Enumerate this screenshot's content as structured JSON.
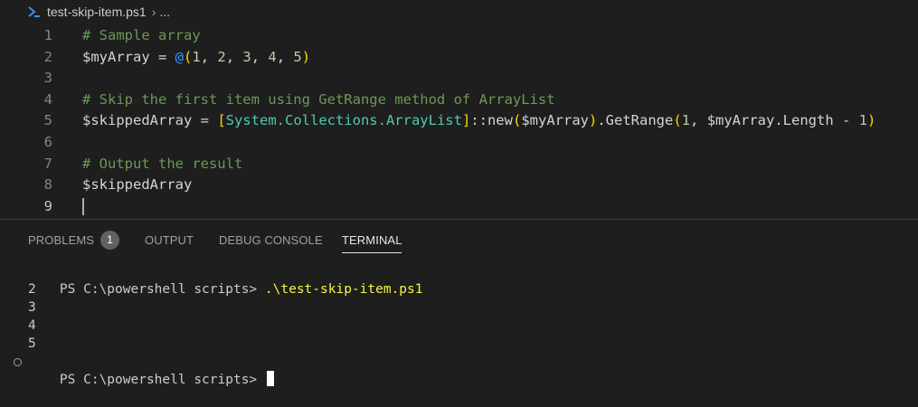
{
  "breadcrumb": {
    "file": "test-skip-item.ps1",
    "chevron": "›",
    "more": "..."
  },
  "editor": {
    "lines": [
      {
        "num": "1",
        "tokens": [
          {
            "t": "# Sample array",
            "k": "comment"
          }
        ]
      },
      {
        "num": "2",
        "tokens": [
          {
            "t": "$myArray",
            "k": "var"
          },
          {
            "t": " = ",
            "k": "op"
          },
          {
            "t": "@",
            "k": "at"
          },
          {
            "t": "(",
            "k": "p1"
          },
          {
            "t": "1",
            "k": "num"
          },
          {
            "t": ", ",
            "k": "plain"
          },
          {
            "t": "2",
            "k": "num"
          },
          {
            "t": ", ",
            "k": "plain"
          },
          {
            "t": "3",
            "k": "num"
          },
          {
            "t": ", ",
            "k": "plain"
          },
          {
            "t": "4",
            "k": "num"
          },
          {
            "t": ", ",
            "k": "plain"
          },
          {
            "t": "5",
            "k": "num"
          },
          {
            "t": ")",
            "k": "p1"
          }
        ]
      },
      {
        "num": "3",
        "tokens": []
      },
      {
        "num": "4",
        "tokens": [
          {
            "t": "# Skip the first item using GetRange method of ArrayList",
            "k": "comment"
          }
        ]
      },
      {
        "num": "5",
        "tokens": [
          {
            "t": "$skippedArray",
            "k": "var"
          },
          {
            "t": " = ",
            "k": "op"
          },
          {
            "t": "[",
            "k": "p1"
          },
          {
            "t": "System.Collections.ArrayList",
            "k": "type"
          },
          {
            "t": "]",
            "k": "p1"
          },
          {
            "t": "::new",
            "k": "plain"
          },
          {
            "t": "(",
            "k": "p1"
          },
          {
            "t": "$myArray",
            "k": "var"
          },
          {
            "t": ")",
            "k": "p1"
          },
          {
            "t": ".GetRange",
            "k": "plain"
          },
          {
            "t": "(",
            "k": "p1"
          },
          {
            "t": "1",
            "k": "num"
          },
          {
            "t": ", ",
            "k": "plain"
          },
          {
            "t": "$myArray",
            "k": "var"
          },
          {
            "t": ".Length - ",
            "k": "plain"
          },
          {
            "t": "1",
            "k": "num"
          },
          {
            "t": ")",
            "k": "p1"
          }
        ]
      },
      {
        "num": "6",
        "tokens": []
      },
      {
        "num": "7",
        "tokens": [
          {
            "t": "# Output the result",
            "k": "comment"
          }
        ]
      },
      {
        "num": "8",
        "tokens": [
          {
            "t": "$skippedArray",
            "k": "var"
          }
        ]
      },
      {
        "num": "9",
        "tokens": [],
        "active": true
      }
    ]
  },
  "panel": {
    "tabs": [
      {
        "label": "PROBLEMS",
        "active": false
      },
      {
        "label": "OUTPUT",
        "active": false
      },
      {
        "label": "DEBUG CONSOLE",
        "active": false
      },
      {
        "label": "TERMINAL",
        "active": true
      }
    ],
    "problems_count": "1"
  },
  "terminal": {
    "prompt1": "PS C:\\powershell scripts> ",
    "command": ".\\test-skip-item.ps1",
    "output": [
      "2",
      "3",
      "4",
      "5"
    ],
    "prompt2": "PS C:\\powershell scripts> "
  },
  "colors": {
    "background": "#1e1e1e",
    "comment": "#6a9955",
    "number": "#b5cea8",
    "type": "#4ec9b0",
    "bracket1": "#ffd700",
    "command": "#f5f543"
  },
  "icons": {
    "breadcrumb": "powershell-icon",
    "terminal_gutter": "circle-icon"
  }
}
